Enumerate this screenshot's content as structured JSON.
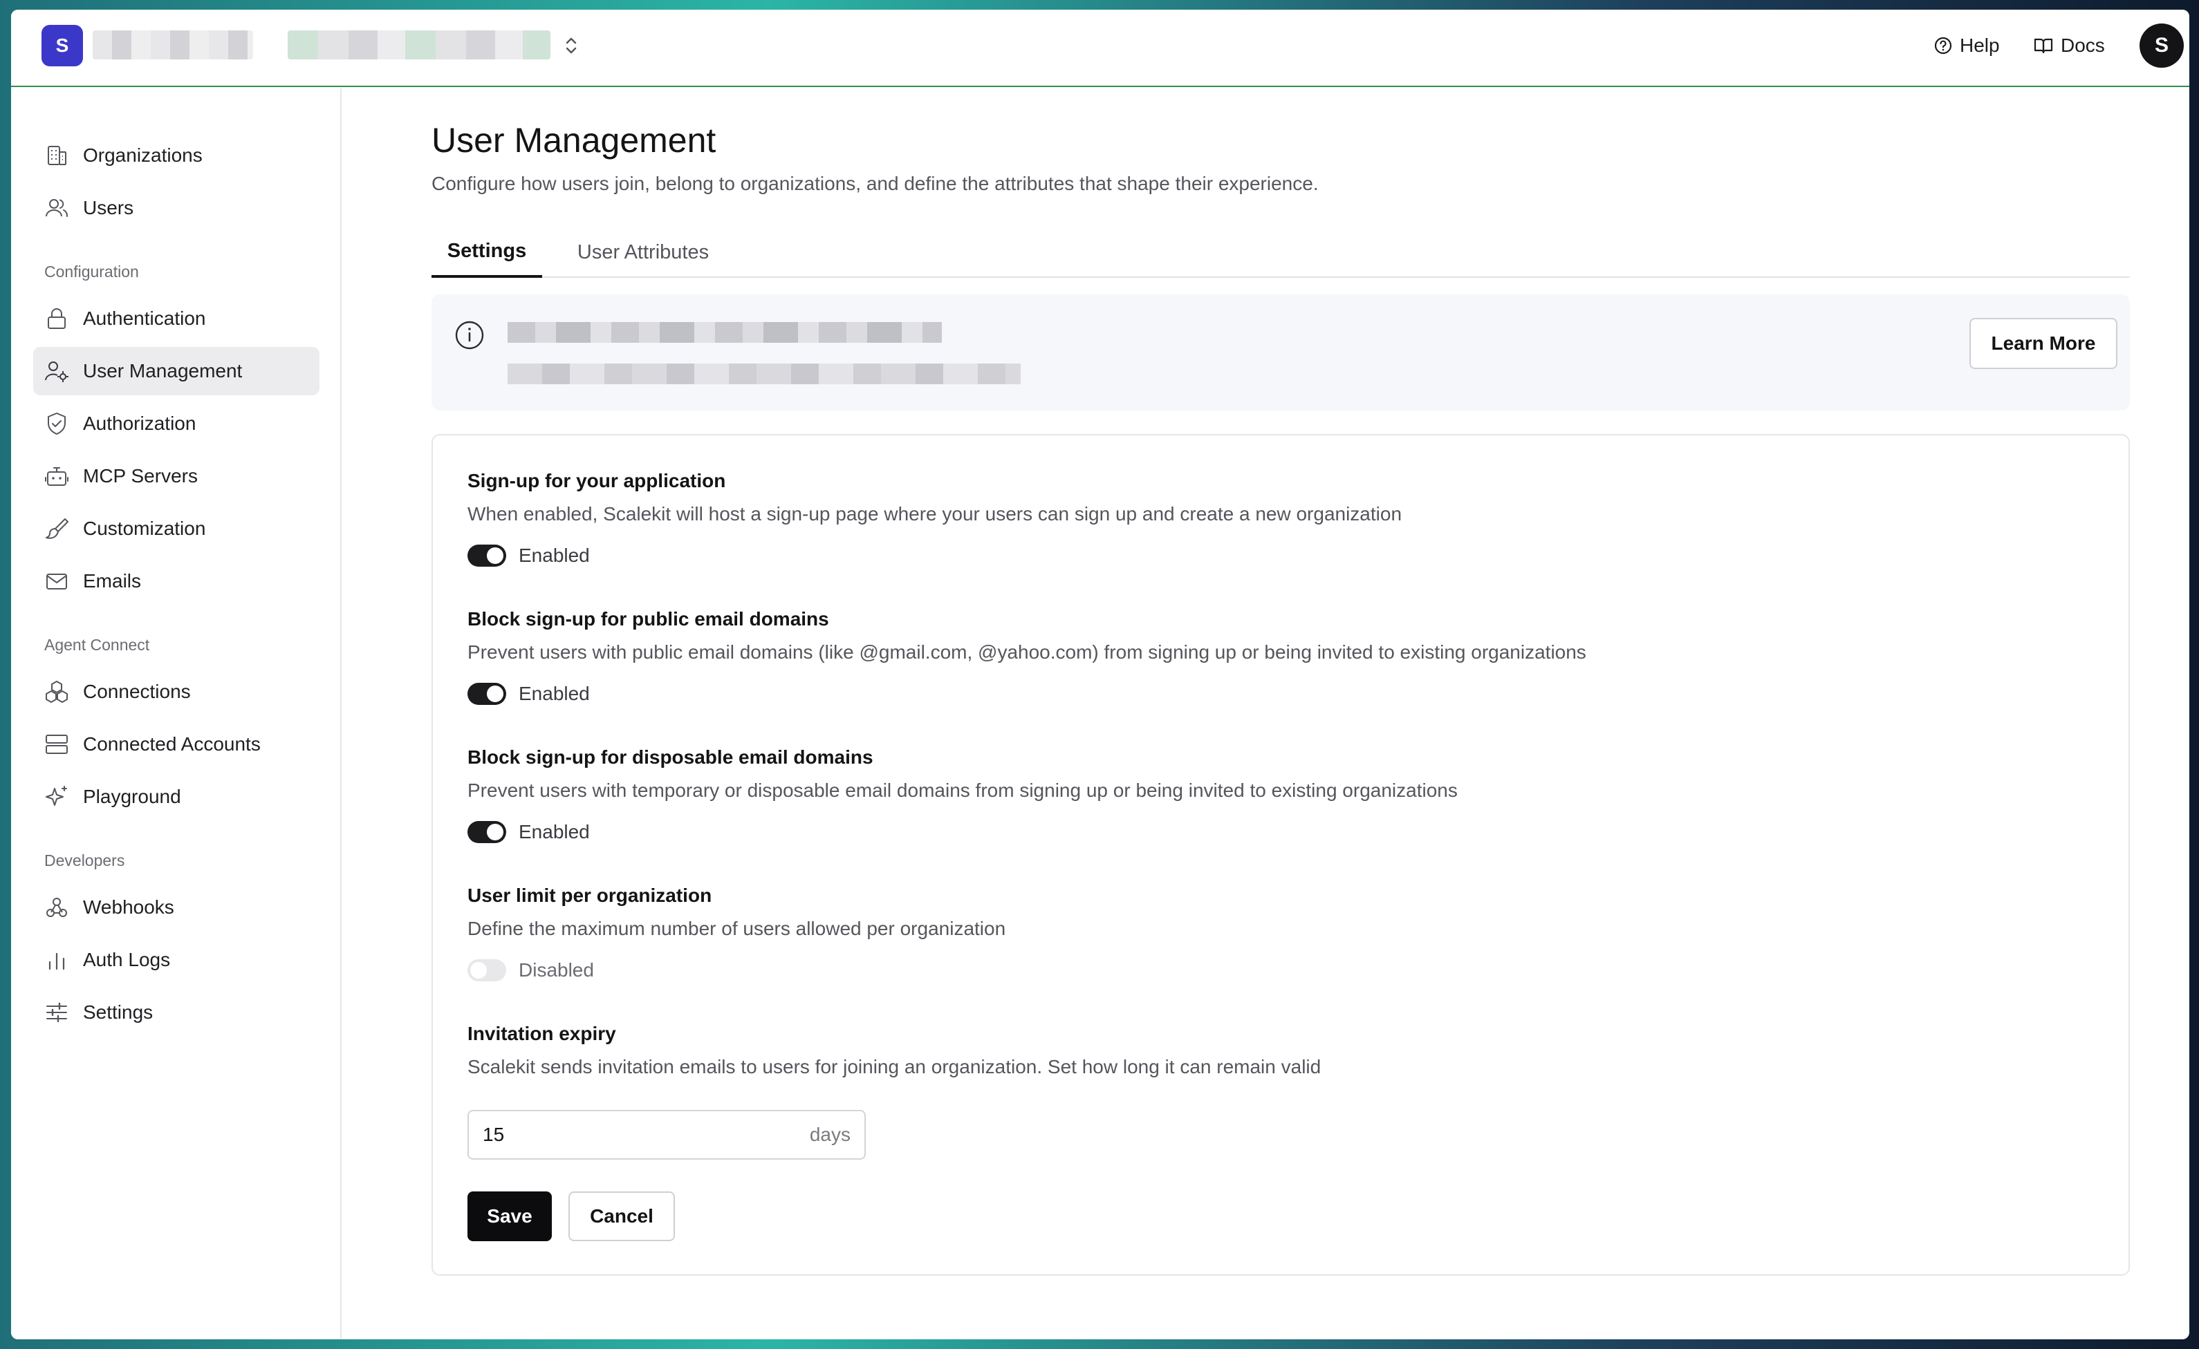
{
  "topbar": {
    "logo_letter": "S",
    "help_label": "Help",
    "docs_label": "Docs",
    "avatar_letter": "S"
  },
  "sidebar": {
    "items_top": [
      {
        "label": "Organizations",
        "icon": "building-icon"
      },
      {
        "label": "Users",
        "icon": "users-icon"
      }
    ],
    "section_configuration": "Configuration",
    "items_configuration": [
      {
        "label": "Authentication",
        "icon": "lock-icon"
      },
      {
        "label": "User Management",
        "icon": "user-cog-icon",
        "active": true
      },
      {
        "label": "Authorization",
        "icon": "shield-check-icon"
      },
      {
        "label": "MCP Servers",
        "icon": "robot-icon"
      },
      {
        "label": "Customization",
        "icon": "paintbrush-icon"
      },
      {
        "label": "Emails",
        "icon": "mail-icon"
      }
    ],
    "section_agent": "Agent Connect",
    "items_agent": [
      {
        "label": "Connections",
        "icon": "boxes-icon"
      },
      {
        "label": "Connected Accounts",
        "icon": "server-icon"
      },
      {
        "label": "Playground",
        "icon": "sparkles-icon"
      }
    ],
    "section_developers": "Developers",
    "items_developers": [
      {
        "label": "Webhooks",
        "icon": "webhook-icon"
      },
      {
        "label": "Auth Logs",
        "icon": "bar-chart-icon"
      },
      {
        "label": "Settings",
        "icon": "sliders-icon"
      }
    ]
  },
  "main": {
    "title": "User Management",
    "subtitle": "Configure how users join, belong to organizations, and define the attributes that shape their experience.",
    "tabs": [
      {
        "label": "Settings",
        "active": true
      },
      {
        "label": "User Attributes",
        "active": false
      }
    ],
    "banner": {
      "learn_more_label": "Learn More"
    },
    "settings": [
      {
        "title": "Sign-up for your application",
        "description": "When enabled, Scalekit will host a sign-up page where your users can sign up and create a new organization",
        "enabled": true,
        "state_label": "Enabled"
      },
      {
        "title": "Block sign-up for public email domains",
        "description": "Prevent users with public email domains (like @gmail.com, @yahoo.com) from signing up or being invited to existing organizations",
        "enabled": true,
        "state_label": "Enabled"
      },
      {
        "title": "Block sign-up for disposable email domains",
        "description": "Prevent users with temporary or disposable email domains from signing up or being invited to existing organizations",
        "enabled": true,
        "state_label": "Enabled"
      },
      {
        "title": "User limit per organization",
        "description": "Define the maximum number of users allowed per organization",
        "enabled": false,
        "state_label": "Disabled"
      }
    ],
    "invitation": {
      "title": "Invitation expiry",
      "description": "Scalekit sends invitation emails to users for joining an organization. Set how long it can remain valid",
      "value": "15",
      "unit": "days"
    },
    "buttons": {
      "save_label": "Save",
      "cancel_label": "Cancel"
    }
  }
}
